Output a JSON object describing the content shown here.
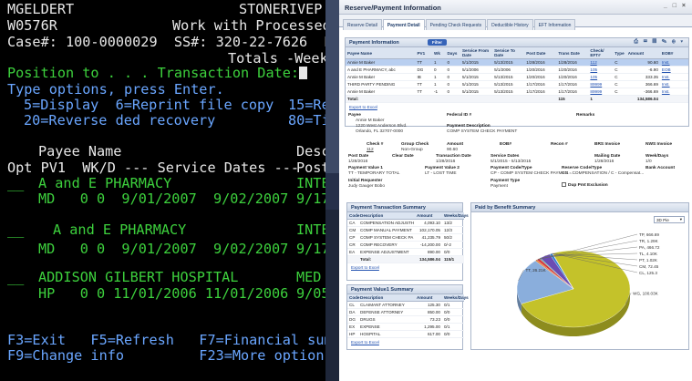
{
  "terminal": {
    "user": "MGELDERT",
    "system": "STONERIVEP",
    "screen_id": "W0576R",
    "title": "Work with Processed",
    "case_line": "Case#: 100-0000029  SS#: 320-22-7626  Bak",
    "totals": "Totals -Weeks",
    "position_prompt": "Position to . . . Transaction Date:",
    "type_options": "Type options, press Enter.",
    "options_row1": "5=Display  6=Reprint file copy",
    "options_row1b": "15=Re",
    "options_row2": "20=Reverse ded recovery",
    "options_row2b": "80=Ti",
    "header1": "Payee Name",
    "header1b": "Desc",
    "header2": "Opt PV1  WK/D --- Service Dates ---",
    "header2b": "Post",
    "rows": [
      {
        "opt": "__",
        "name": "A and E PHARMACY",
        "desc": "INTE",
        "detail": "MD   0 0  9/01/2007  9/02/2007",
        "post": "9/17"
      },
      {
        "opt": "__",
        "name": "A and E PHARMACY",
        "desc": "INTE",
        "detail": "MD   0 0  9/01/2007  9/02/2007",
        "post": "9/17"
      },
      {
        "opt": "__",
        "name": "ADDISON GILBERT HOSPITAL",
        "desc": "MED",
        "detail": "HP   0 0 11/01/2006 11/01/2006",
        "post": "9/05"
      }
    ],
    "fkeys1": "F3=Exit   F5=Refresh   F7=Financial summa",
    "fkeys2": "F9=Change info         F23=More options"
  },
  "web": {
    "window_title": "Reserve/Payment Information",
    "window_buttons": "_ □ ×",
    "tabs": [
      "Reserve Detail",
      "Payment Detail",
      "Pending Check Requests",
      "Deductible History",
      "EFT Information"
    ],
    "active_tab": 1,
    "payment_info": {
      "title": "Payment Information",
      "filter": "Filter",
      "toolbar_icons": "⎙ ✉ ▤ ✎ ⊕ ▾",
      "columns": [
        "Payee Name",
        "PV1",
        "Wk",
        "Days",
        "Service From Date",
        "Service To Date",
        "Post Date",
        "Trans Date",
        "Check/ EFT#",
        "Type",
        "Amount",
        "EOB#"
      ],
      "rows": [
        {
          "cells": [
            "Annie M Baker",
            "TT",
            "1",
            "0",
            "5/1/2015",
            "5/13/2015",
            "1/28/2016",
            "1/28/2016",
            "112",
            "C",
            "90.60",
            "Inst."
          ],
          "selected": true
        },
        {
          "cells": [
            "A and E PHARMACY, abc",
            "DG",
            "0",
            "0",
            "5/1/2006",
            "5/1/2006",
            "1/20/2016",
            "1/20/2016",
            "105",
            "C",
            "-6.90",
            "EOB"
          ],
          "selected": false
        },
        {
          "cells": [
            "Annie M Baker",
            "IB",
            "1",
            "0",
            "5/1/2015",
            "5/13/2015",
            "1/20/2016",
            "1/20/2016",
            "105",
            "C",
            "333.35",
            "Inst."
          ],
          "selected": false
        },
        {
          "cells": [
            "THIRD PARTY PENDING",
            "TT",
            "1",
            "0",
            "5/1/2015",
            "5/13/2015",
            "1/17/2016",
            "1/17/2016",
            "89999",
            "C",
            "366.69",
            "Inst."
          ],
          "selected": false
        },
        {
          "cells": [
            "Annie M Baker",
            "TT",
            "-1",
            "0",
            "5/1/2015",
            "5/13/2015",
            "1/17/2016",
            "1/17/2016",
            "89999",
            "C",
            "-366.69",
            "Inst."
          ],
          "selected": false
        }
      ],
      "total_label": "Total:",
      "total_count": "115",
      "total_sub": "1",
      "total_amount": "134,586.04"
    },
    "export_label": "Export to Excel",
    "detail": {
      "payee_label": "Payee",
      "payee_name": "Annie M Baker",
      "payee_addr1": "1220 West Anderson Blvd.",
      "payee_addr2": "Orlando, FL 32707-0000",
      "federal_id_label": "Federal ID #",
      "payment_desc_label": "Payment Description",
      "payment_desc": "COMP SYSTEM CHECK PAYMENT",
      "remarks_label": "Remarks",
      "check_label": "Check #",
      "check_val": "112",
      "group_check_label": "Group Check",
      "group_check_val": "Non-Group",
      "amount_label": "Amount",
      "amount_val": "90.60",
      "eob_label": "EOB#",
      "recon_label": "Recon #",
      "brs_label": "BRS Invoice",
      "nws_label": "NWS Invoice",
      "post_date_label": "Post Date",
      "post_date_val": "1/28/2016",
      "clear_date_label": "Clear Date",
      "trans_date_label": "Transaction Date",
      "trans_date_val": "1/28/2016",
      "service_dates_label": "Service Dates",
      "service_dates_val": "5/1/2015 - 5/13/2015",
      "mailing_date_label": "Mailing Date",
      "mailing_date_val": "1/28/2016",
      "week_days_label": "Week/Days",
      "week_days_val": "1/0",
      "pv1_label": "Payment Value 1",
      "pv1_val": "TT - TEMPORARY TOTAL",
      "pv2_label": "Payment Value 2",
      "pv2_val": "LT - LOST TIME",
      "paycode_label": "Payment Code/Type",
      "paycode_val": "CP - COMP SYSTEM CHECK PAYMEN...",
      "rescode_label": "Reserve Code/Type",
      "rescode_val": "CO - COMPENSATION / C - Compensat...",
      "bank_label": "Bank Account",
      "init_req_label": "Initial Requester",
      "init_req_val": "Judy Gauger Bobo",
      "paytype_label": "Payment Type",
      "paytype_val": "Payment",
      "dup_label": "Dup Pmt Exclusion"
    },
    "pts": {
      "title": "Payment Transaction Summary",
      "columns": [
        "Code",
        "Description",
        "Amount",
        "Weeks/Days"
      ],
      "rows": [
        [
          "CA",
          "COMPENSATION ADJUSTH",
          "4,093.10",
          "13/2"
        ],
        [
          "CM",
          "COMP MANUAL PAYMENT",
          "102,170.05",
          "12/3"
        ],
        [
          "CP",
          "COMP SYSTEM CHECK PA",
          "41,235.79",
          "50/2"
        ],
        [
          "CR",
          "COMP RECOVERY",
          "-14,200.00",
          "0/-2"
        ],
        [
          "EA",
          "EXPENSE ADJUSTMENT",
          "890.00",
          "0/0"
        ]
      ],
      "total_label": "Total:",
      "total_amount": "134,586.04",
      "total_wd": "115/1"
    },
    "pvs": {
      "title": "Payment Value1 Summary",
      "columns": [
        "Code",
        "Description",
        "Amount",
        "Weeks/Days"
      ],
      "rows": [
        [
          "CL",
          "CLAIMANT ATTORNEY",
          "125.30",
          "0/1"
        ],
        [
          "DA",
          "DEFENSE ATTORNEY",
          "850.00",
          "0/0"
        ],
        [
          "DG",
          "DRUGS",
          "73.23",
          "0/0"
        ],
        [
          "EX",
          "EXPENSE",
          "1,295.00",
          "0/1"
        ],
        [
          "HP",
          "HOSPITAL",
          "617.00",
          "0/0"
        ]
      ]
    },
    "pie": {
      "title": "Paid by Benefit Summary",
      "dropdown": "3D Pie",
      "chart_data": {
        "type": "pie",
        "title": "Paid by Benefit Summary",
        "slices": [
          {
            "label": "WG",
            "value": 100.03,
            "display": "WG, 100.03K",
            "color": "#c4c22a"
          },
          {
            "label": "TT",
            "value": 26.21,
            "display": "TT, 26.21K",
            "color": "#8aaedc"
          },
          {
            "label": "TP",
            "value": 0.67,
            "display": "TP, 666.69",
            "color": "#e07b2a"
          },
          {
            "label": "TR",
            "value": 1.29,
            "display": "TR, 1.29K",
            "color": "#d63c3c"
          },
          {
            "label": "PA",
            "value": 0.47,
            "display": "PA, 466.72",
            "color": "#3aa5a0"
          },
          {
            "label": "TL",
            "value": 4.1,
            "display": "TL, 4.10K",
            "color": "#6b4db3"
          },
          {
            "label": "PT",
            "value": 1.02,
            "display": "PT, 1.02K",
            "color": "#2f7fd1"
          },
          {
            "label": "CM",
            "value": 0.07,
            "display": "CM, 72.45",
            "color": "#e3b235"
          },
          {
            "label": "CL",
            "value": 0.13,
            "display": "CL, 125.3",
            "color": "#9b5a2a"
          }
        ]
      }
    }
  }
}
